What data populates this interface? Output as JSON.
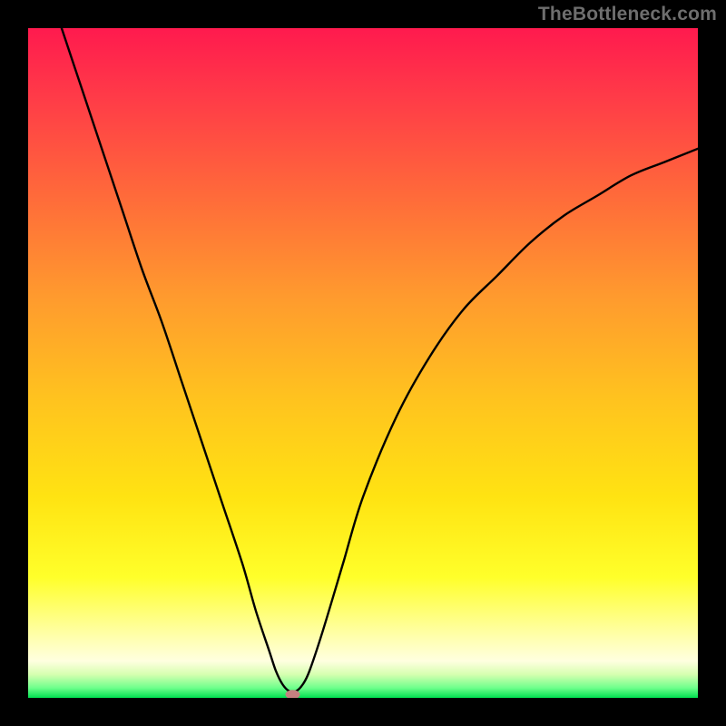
{
  "watermark": "TheBottleneck.com",
  "chart_data": {
    "type": "line",
    "title": "",
    "xlabel": "",
    "ylabel": "",
    "xlim": [
      0,
      100
    ],
    "ylim": [
      0,
      100
    ],
    "grid": false,
    "legend": false,
    "background_gradient": {
      "top_color": "#ff1a4e",
      "mid_color_1": "#ff7a33",
      "mid_color_2": "#ffd700",
      "lower_color": "#ffff66",
      "bottom_color": "#00e050"
    },
    "series": [
      {
        "name": "bottleneck-curve",
        "color": "#000000",
        "x": [
          5,
          8,
          11,
          14,
          17,
          20,
          23,
          26,
          29,
          32,
          34,
          36,
          37,
          38,
          39,
          40,
          41,
          42,
          44,
          47,
          50,
          55,
          60,
          65,
          70,
          75,
          80,
          85,
          90,
          95,
          100
        ],
        "y": [
          100,
          91,
          82,
          73,
          64,
          56,
          47,
          38,
          29,
          20,
          13,
          7,
          4,
          2,
          1,
          1,
          2,
          4,
          10,
          20,
          30,
          42,
          51,
          58,
          63,
          68,
          72,
          75,
          78,
          80,
          82
        ]
      }
    ],
    "marker": {
      "name": "min-point-marker",
      "x": 39.5,
      "y": 0.5,
      "color": "#c58080",
      "shape": "ellipse"
    }
  }
}
